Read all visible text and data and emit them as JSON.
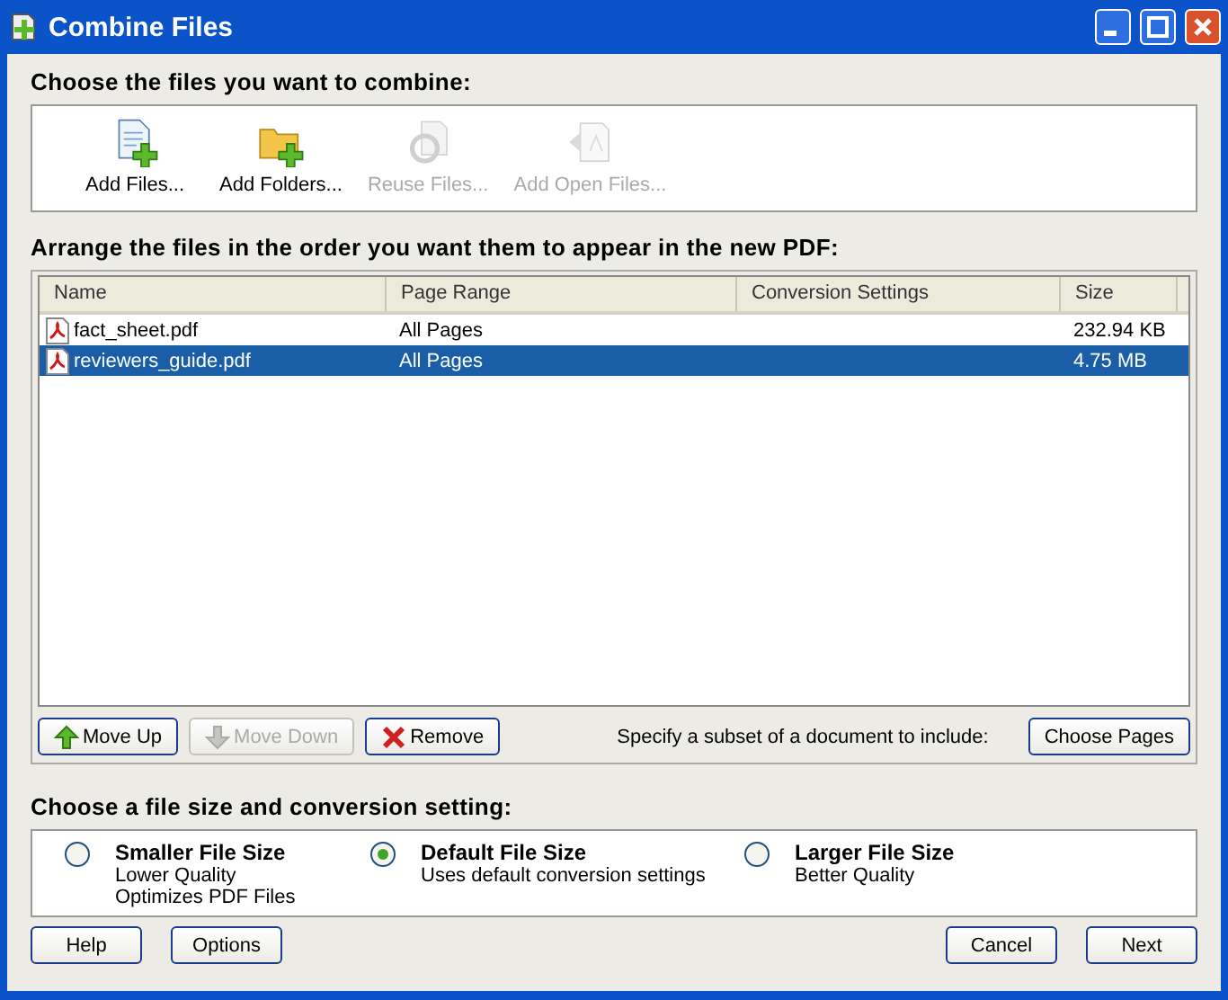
{
  "window": {
    "title": "Combine Files"
  },
  "add_section": {
    "heading": "Choose the files you want to combine:",
    "tools": [
      {
        "kind": "file",
        "label": "Add Files...",
        "disabled": false
      },
      {
        "kind": "folder",
        "label": "Add Folders...",
        "disabled": false
      },
      {
        "kind": "reuse",
        "label": "Reuse Files...",
        "disabled": true
      },
      {
        "kind": "open",
        "label": "Add Open Files...",
        "disabled": true
      }
    ]
  },
  "arrange_section": {
    "heading": "Arrange the files in the order you want them to appear in the new PDF:",
    "table": {
      "columns": [
        "Name",
        "Page Range",
        "Conversion Settings",
        "Size"
      ],
      "rows": [
        {
          "name": "fact_sheet.pdf",
          "page_range": "All Pages",
          "size": "232.94 KB",
          "selected": false
        },
        {
          "name": "reviewers_guide.pdf",
          "page_range": "All Pages",
          "size": "4.75 MB",
          "selected": true
        }
      ]
    },
    "buttons": [
      {
        "kind": "up",
        "label": "Move Up",
        "disabled": false
      },
      {
        "kind": "down",
        "label": "Move Down",
        "disabled": true
      },
      {
        "kind": "remove",
        "label": "Remove",
        "disabled": false
      }
    ],
    "subset_label": "Specify a subset of a document to include:",
    "choose_button": "Choose Pages"
  },
  "size_section": {
    "heading": "Choose a file size and conversion setting:",
    "options": [
      {
        "title": "Smaller File Size",
        "lines": [
          "Lower Quality",
          "Optimizes PDF Files"
        ],
        "selected": false
      },
      {
        "title": "Default File Size",
        "lines": [
          "Uses default conversion settings"
        ],
        "selected": true
      },
      {
        "title": "Larger File Size",
        "lines": [
          "Better Quality"
        ],
        "selected": false
      }
    ]
  },
  "footer": {
    "left": [
      "Help",
      "Options"
    ],
    "right": [
      "Cancel",
      "Next"
    ]
  }
}
